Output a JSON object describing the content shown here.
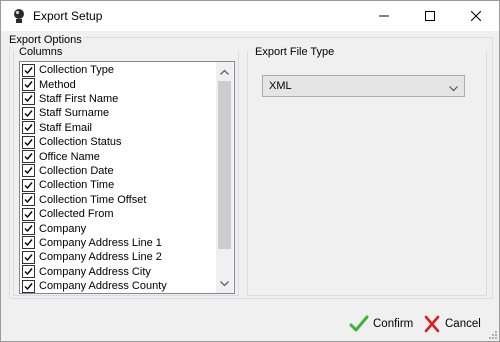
{
  "window": {
    "title": "Export Setup",
    "controls": {
      "minimize": "minimize-icon",
      "maximize": "maximize-icon",
      "close": "close-icon"
    }
  },
  "export_options": {
    "legend": "Export Options",
    "columns": {
      "legend": "Columns",
      "items": [
        {
          "label": "Collection Type",
          "checked": true
        },
        {
          "label": "Method",
          "checked": true
        },
        {
          "label": "Staff First Name",
          "checked": true
        },
        {
          "label": "Staff Surname",
          "checked": true
        },
        {
          "label": "Staff Email",
          "checked": true
        },
        {
          "label": "Collection Status",
          "checked": true
        },
        {
          "label": "Office Name",
          "checked": true
        },
        {
          "label": "Collection Date",
          "checked": true
        },
        {
          "label": "Collection Time",
          "checked": true
        },
        {
          "label": "Collection Time Offset",
          "checked": true
        },
        {
          "label": "Collected From",
          "checked": true
        },
        {
          "label": "Company",
          "checked": true
        },
        {
          "label": "Company Address Line 1",
          "checked": true
        },
        {
          "label": "Company Address Line 2",
          "checked": true
        },
        {
          "label": "Company Address City",
          "checked": true
        },
        {
          "label": "Company Address County",
          "checked": true
        }
      ]
    },
    "file_type": {
      "legend": "Export File Type",
      "selected": "XML"
    }
  },
  "actions": {
    "confirm_label": "Confirm",
    "cancel_label": "Cancel"
  },
  "colors": {
    "confirm_check": "#3cb43c",
    "cancel_x": "#d92020"
  }
}
